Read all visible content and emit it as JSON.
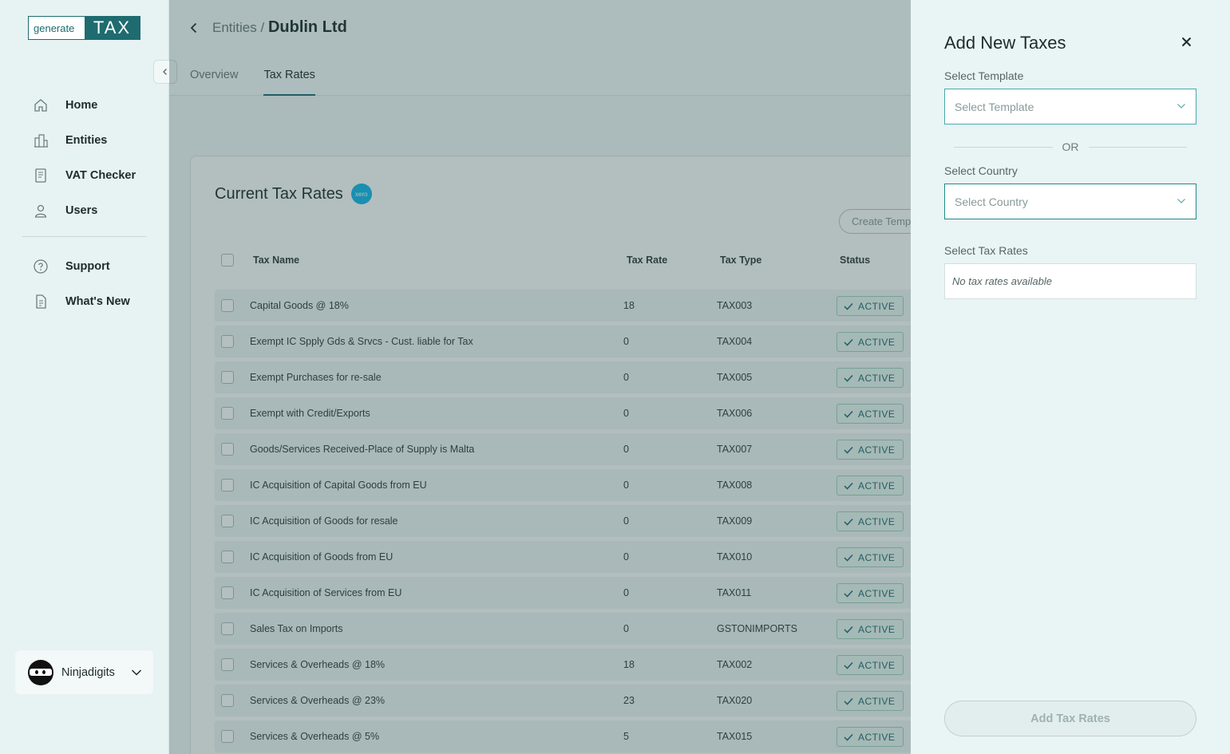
{
  "logo": {
    "part1": "generate",
    "part2": "TAX"
  },
  "sidebar": {
    "items": [
      {
        "label": "Home",
        "icon": "home-icon"
      },
      {
        "label": "Entities",
        "icon": "building-icon"
      },
      {
        "label": "VAT Checker",
        "icon": "document-icon"
      },
      {
        "label": "Users",
        "icon": "user-icon"
      }
    ],
    "items2": [
      {
        "label": "Support",
        "icon": "help-icon"
      },
      {
        "label": "What's New",
        "icon": "news-icon"
      }
    ],
    "user": {
      "name": "Ninjadigits"
    }
  },
  "header": {
    "breadcrumb_parent": "Entities /",
    "title": "Dublin Ltd",
    "tabs": [
      {
        "label": "Overview",
        "active": false
      },
      {
        "label": "Tax Rates",
        "active": true
      }
    ]
  },
  "card": {
    "title": "Current Tax Rates",
    "xero_label": "xero",
    "create_button": "Create Template",
    "columns": [
      "Tax Name",
      "Tax Rate",
      "Tax Type",
      "Status"
    ],
    "rows": [
      {
        "name": "Capital Goods @ 18%",
        "rate": "18",
        "type": "TAX003",
        "status": "ACTIVE"
      },
      {
        "name": "Exempt IC Spply Gds & Srvcs - Cust. liable for Tax",
        "rate": "0",
        "type": "TAX004",
        "status": "ACTIVE"
      },
      {
        "name": "Exempt Purchases for re-sale",
        "rate": "0",
        "type": "TAX005",
        "status": "ACTIVE"
      },
      {
        "name": "Exempt with Credit/Exports",
        "rate": "0",
        "type": "TAX006",
        "status": "ACTIVE"
      },
      {
        "name": "Goods/Services Received-Place of Supply is Malta",
        "rate": "0",
        "type": "TAX007",
        "status": "ACTIVE"
      },
      {
        "name": "IC Acquisition of Capital Goods from EU",
        "rate": "0",
        "type": "TAX008",
        "status": "ACTIVE"
      },
      {
        "name": "IC Acquisition of Goods for resale",
        "rate": "0",
        "type": "TAX009",
        "status": "ACTIVE"
      },
      {
        "name": "IC Acquisition of Goods from EU",
        "rate": "0",
        "type": "TAX010",
        "status": "ACTIVE"
      },
      {
        "name": "IC Acquisition of Services from EU",
        "rate": "0",
        "type": "TAX011",
        "status": "ACTIVE"
      },
      {
        "name": "Sales Tax on Imports",
        "rate": "0",
        "type": "GSTONIMPORTS",
        "status": "ACTIVE"
      },
      {
        "name": "Services & Overheads @ 18%",
        "rate": "18",
        "type": "TAX002",
        "status": "ACTIVE"
      },
      {
        "name": "Services & Overheads @ 23%",
        "rate": "23",
        "type": "TAX020",
        "status": "ACTIVE"
      },
      {
        "name": "Services & Overheads @ 5%",
        "rate": "5",
        "type": "TAX015",
        "status": "ACTIVE"
      }
    ]
  },
  "drawer": {
    "title": "Add New Taxes",
    "template_label": "Select Template",
    "template_placeholder": "Select Template",
    "or_text": "OR",
    "country_label": "Select Country",
    "country_placeholder": "Select Country",
    "tax_rates_label": "Select Tax Rates",
    "no_tax_rates": "No tax rates available",
    "add_button": "Add Tax Rates"
  },
  "colors": {
    "brand": "#1e6b70",
    "accent": "#1e8a88",
    "active_badge": "#e9f6f1"
  }
}
